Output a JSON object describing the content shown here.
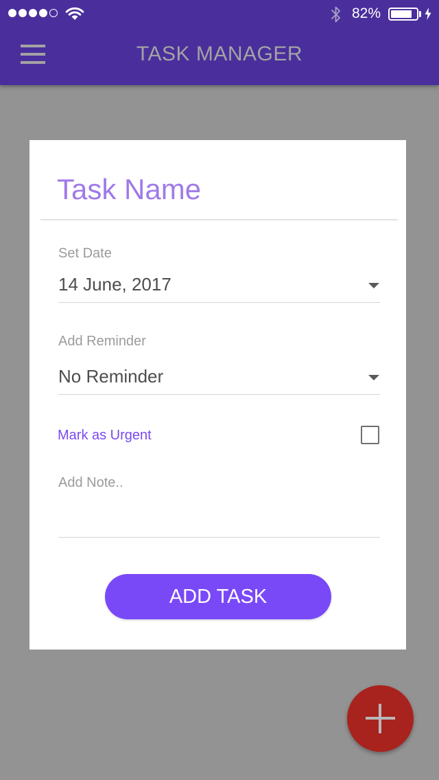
{
  "status_bar": {
    "signal_bars": 4,
    "signal_total": 5,
    "battery_percent": "82%",
    "battery_level": 0.82
  },
  "app_bar": {
    "title": "TASK MANAGER",
    "menu_icon": "hamburger-menu-icon"
  },
  "form": {
    "task_name_placeholder": "Task Name",
    "date": {
      "label": "Set Date",
      "value": "14 June, 2017"
    },
    "reminder": {
      "label": "Add Reminder",
      "value": "No Reminder"
    },
    "urgent": {
      "label": "Mark as Urgent",
      "checked": false
    },
    "note_placeholder": "Add Note..",
    "submit_label": "ADD TASK"
  },
  "fab": {
    "icon": "plus-icon"
  },
  "colors": {
    "app_bar": "#4a2f9c",
    "accent": "#7a49f7",
    "fab": "#a8231e",
    "background": "#939393"
  }
}
